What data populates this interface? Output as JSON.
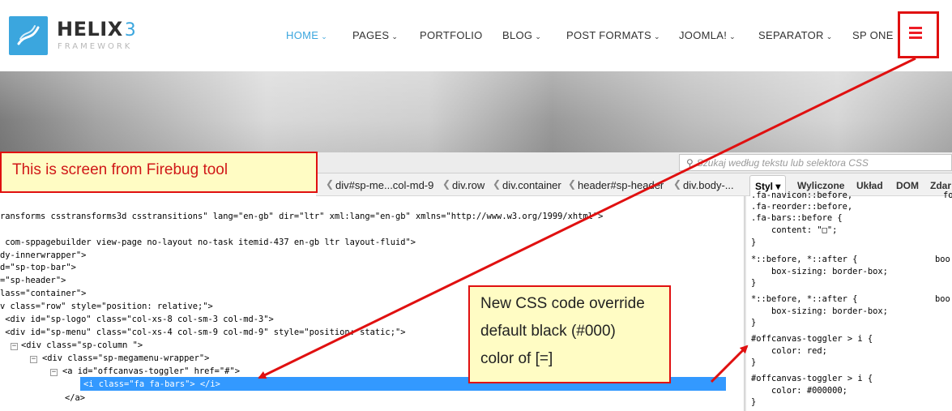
{
  "site": {
    "logo_title": "HELIX",
    "logo_num": "3",
    "logo_sub": "FRAMEWORK",
    "nav": [
      {
        "label": "HOME",
        "chevron": "chevron-down-icon"
      },
      {
        "label": "PAGES",
        "chevron": "chevron-down-icon"
      },
      {
        "label": "PORTFOLIO"
      },
      {
        "label": "BLOG",
        "chevron": "chevron-down-icon"
      },
      {
        "label": "POST FORMATS",
        "chevron": "chevron-down-icon"
      },
      {
        "label": "JOOMLA!",
        "chevron": "chevron-down-icon"
      },
      {
        "label": "SEPARATOR",
        "chevron": "chevron-down-icon"
      },
      {
        "label": "SP ONE"
      }
    ],
    "menu_icon": "hamburger-icon",
    "accent": "#3ba6de",
    "menu_icon_color": "#ee1c25"
  },
  "firebug": {
    "search_placeholder": "Szukaj według tekstu lub selektora CSS",
    "breadcrumbs": [
      "div#sp-me...col-md-9",
      "div.row",
      "div.container",
      "header#sp-header",
      "div.body-..."
    ],
    "panel_tabs": [
      "Styl",
      "Wyliczone",
      "Układ",
      "DOM",
      "Zdar"
    ],
    "html_lines": [
      {
        "tag": "",
        "text": "ransforms csstransforms3d csstransitions\" lang=\"en-gb\" dir=\"ltr\" xml:lang=\"en-gb\" xmlns=\"http://www.w3.org/1999/xhtml\">"
      },
      {
        "tag": "",
        "text": " com-sppagebuilder view-page no-layout no-task itemid-437 en-gb ltr layout-fluid\">"
      },
      {
        "tag": "",
        "text": "dy-innerwrapper\">"
      },
      {
        "tag": "",
        "text": "d=\"sp-top-bar\">"
      },
      {
        "tag": "",
        "text": "=\"sp-header\">"
      },
      {
        "tag": "",
        "text": "lass=\"container\">"
      },
      {
        "tag": "",
        "text": "v class=\"row\" style=\"position: relative;\">"
      },
      {
        "tag": "",
        "text": " <div id=\"sp-logo\" class=\"col-xs-8 col-sm-3 col-md-3\">"
      },
      {
        "tag": "",
        "text": " <div id=\"sp-menu\" class=\"col-xs-4 col-sm-9 col-md-9\" style=\"position: static;\">"
      },
      {
        "tag": "",
        "text": "<div class=\"sp-column \">"
      },
      {
        "tag": "",
        "text": "<div class=\"sp-megamenu-wrapper\">"
      },
      {
        "tag": "",
        "text": "<a id=\"offcanvas-toggler\" href=\"#\">"
      },
      {
        "tag": "",
        "text": "<i class=\"fa fa-bars\"> </i>"
      },
      {
        "tag": "",
        "text": "</a>"
      }
    ],
    "css_rules": [
      {
        "text": ".fa-navicon::before,",
        "src": "fo"
      },
      {
        "text": ".fa-reorder::before,"
      },
      {
        "text": ".fa-bars::before {"
      },
      {
        "text": "    content: \"□\";"
      },
      {
        "text": "}"
      },
      {
        "text": "*::before, *::after {",
        "src": "boo"
      },
      {
        "text": "    box-sizing: border-box;"
      },
      {
        "text": "}"
      },
      {
        "text": "*::before, *::after {",
        "src": "boo"
      },
      {
        "text": "    box-sizing: border-box;"
      },
      {
        "text": "}"
      },
      {
        "text": "#offcanvas-toggler > i {"
      },
      {
        "text": "    color: red;"
      },
      {
        "text": "}"
      },
      {
        "text": "#offcanvas-toggler > i {"
      },
      {
        "text": "    color: #000000;"
      },
      {
        "text": "}"
      }
    ]
  },
  "annotations": {
    "note1": "This is screen from Firebug tool",
    "note2_lines": [
      "New CSS code override",
      "default black (#000)",
      "color of [=]"
    ],
    "color": "#e01010"
  }
}
